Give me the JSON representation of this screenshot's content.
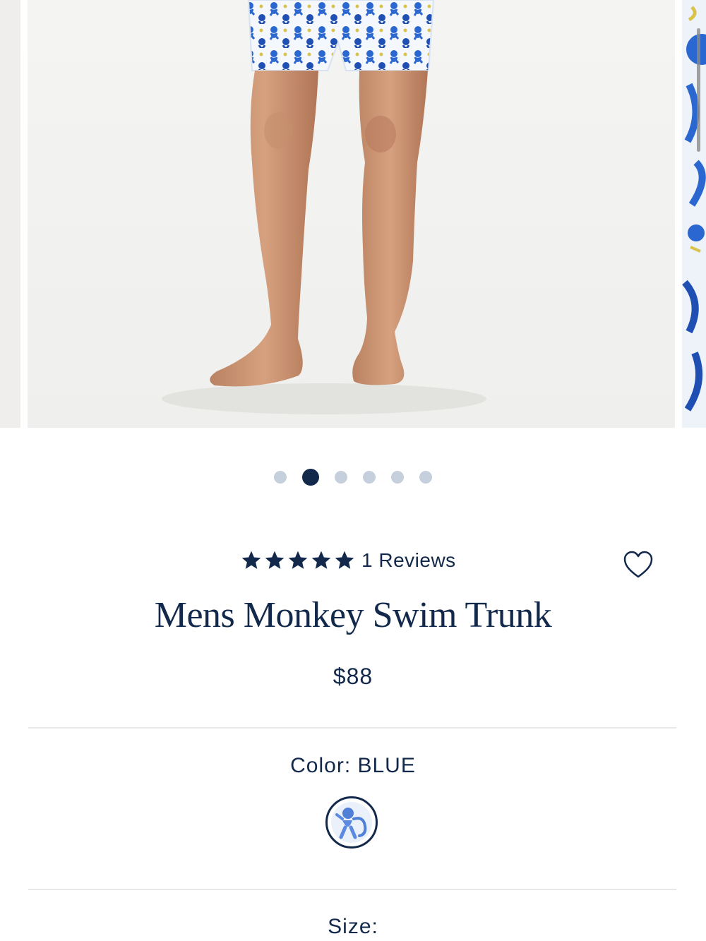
{
  "carousel": {
    "dots_count": 6,
    "active_index": 1
  },
  "product": {
    "rating": 5,
    "reviews_label": "1 Reviews",
    "title": "Mens Monkey Swim Trunk",
    "price": "$88"
  },
  "options": {
    "color_label": "Color: BLUE",
    "size_label": "Size:"
  },
  "icons": {
    "wishlist": "heart-outline-icon",
    "star": "star-icon",
    "swatch": "monkey-pattern-swatch"
  },
  "colors": {
    "brand_navy": "#13294b",
    "dot_inactive": "#c5d0dc",
    "print_blue": "#2b67d1"
  }
}
